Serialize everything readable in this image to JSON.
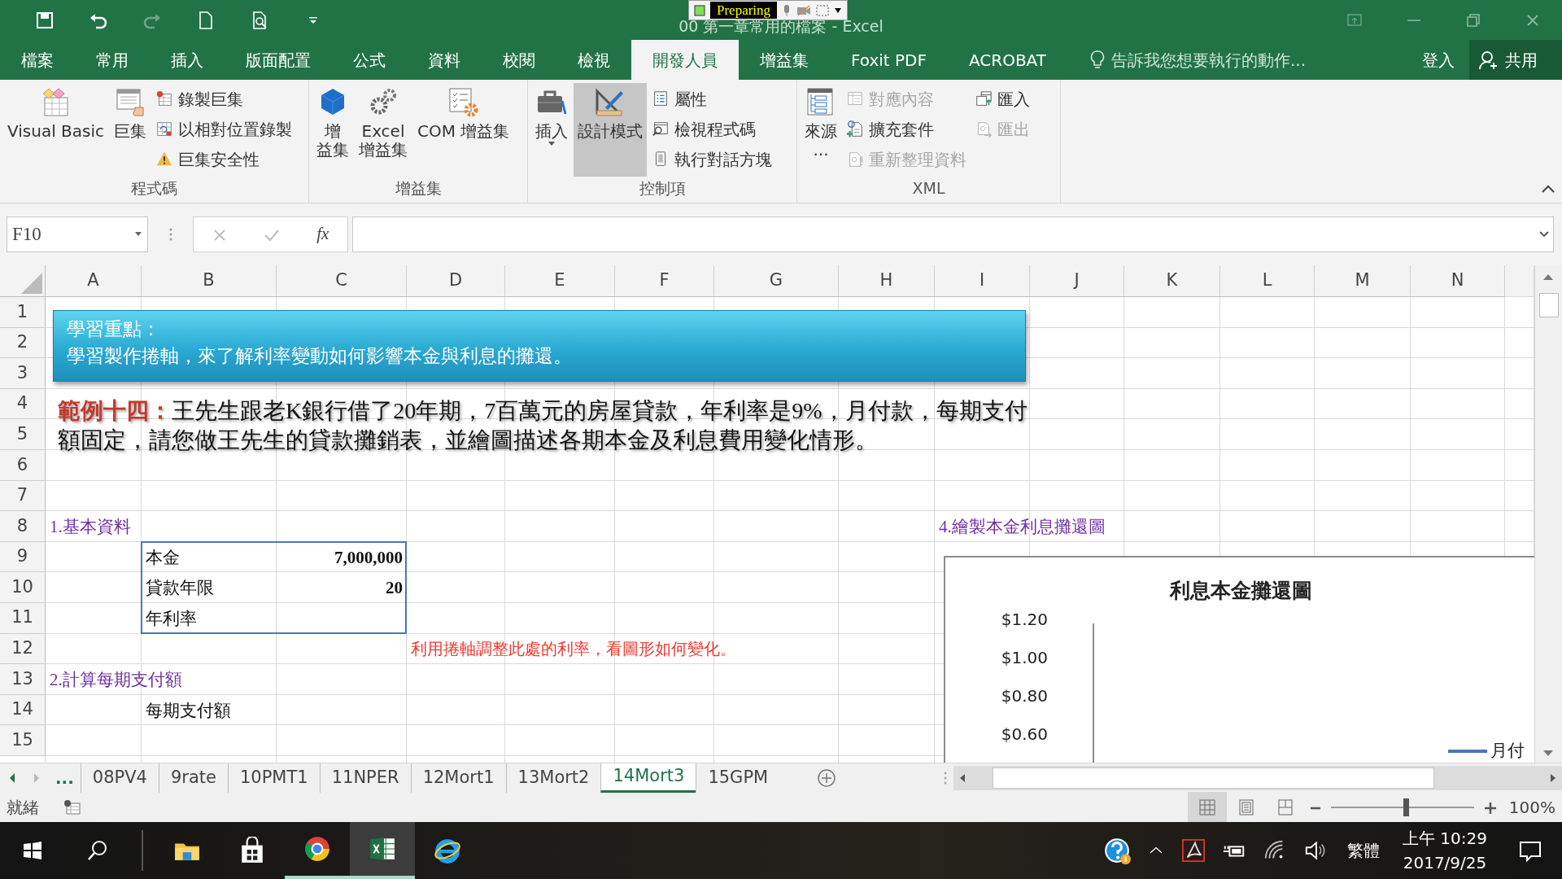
{
  "title_bar": {
    "title": "00 第一章常用的檔案 - Excel",
    "recorder": {
      "status": "Preparing"
    }
  },
  "tabs": [
    {
      "label": "檔案",
      "selected": false
    },
    {
      "label": "常用",
      "selected": false
    },
    {
      "label": "插入",
      "selected": false
    },
    {
      "label": "版面配置",
      "selected": false
    },
    {
      "label": "公式",
      "selected": false
    },
    {
      "label": "資料",
      "selected": false
    },
    {
      "label": "校閱",
      "selected": false
    },
    {
      "label": "檢視",
      "selected": false
    },
    {
      "label": "開發人員",
      "selected": true
    },
    {
      "label": "增益集",
      "selected": false
    },
    {
      "label": "Foxit PDF",
      "selected": false
    },
    {
      "label": "ACROBAT",
      "selected": false
    }
  ],
  "tell_me": {
    "placeholder": "告訴我您想要執行的動作..."
  },
  "sign_in": "登入",
  "share": "共用",
  "ribbon": {
    "groups": [
      {
        "title": "程式碼",
        "items": [
          {
            "kind": "large",
            "lines": [
              "Visual Basic"
            ],
            "pressed": false,
            "dropdown": false
          },
          {
            "kind": "large",
            "lines": [
              "巨集"
            ],
            "pressed": false,
            "dropdown": false
          },
          {
            "kind": "stack",
            "items": [
              {
                "label": "錄製巨集",
                "disabled": false
              },
              {
                "label": "以相對位置錄製",
                "disabled": false
              },
              {
                "label": "巨集安全性",
                "disabled": false
              }
            ]
          }
        ]
      },
      {
        "title": "增益集",
        "items": [
          {
            "kind": "large",
            "lines": [
              "增",
              "益集"
            ],
            "pressed": false,
            "dropdown": false
          },
          {
            "kind": "large",
            "lines": [
              "Excel",
              "增益集"
            ],
            "pressed": false,
            "dropdown": false
          },
          {
            "kind": "large",
            "lines": [
              "COM 增益集"
            ],
            "pressed": false,
            "dropdown": false
          }
        ]
      },
      {
        "title": "控制項",
        "items": [
          {
            "kind": "large",
            "lines": [
              "插入"
            ],
            "pressed": false,
            "dropdown": true
          },
          {
            "kind": "large",
            "lines": [
              "設計模式"
            ],
            "pressed": true,
            "dropdown": false
          },
          {
            "kind": "stack",
            "items": [
              {
                "label": "屬性",
                "disabled": false
              },
              {
                "label": "檢視程式碼",
                "disabled": false
              },
              {
                "label": "執行對話方塊",
                "disabled": false
              }
            ]
          }
        ]
      },
      {
        "title": "XML",
        "items": [
          {
            "kind": "large",
            "lines": [
              "來源",
              "..."
            ],
            "pressed": false,
            "dropdown": false
          },
          {
            "kind": "stack",
            "items": [
              {
                "label": "對應內容",
                "disabled": true
              },
              {
                "label": "擴充套件",
                "disabled": false
              },
              {
                "label": "重新整理資料",
                "disabled": true
              }
            ]
          },
          {
            "kind": "stack",
            "items": [
              {
                "label": "匯入",
                "disabled": false
              },
              {
                "label": "匯出",
                "disabled": true
              }
            ]
          }
        ]
      }
    ]
  },
  "formula_bar": {
    "name_box": "F10",
    "function_label": "fx"
  },
  "sheet": {
    "columns": [
      "A",
      "B",
      "C",
      "D",
      "E",
      "F",
      "G",
      "H",
      "I",
      "J",
      "K",
      "L",
      "M",
      "N"
    ],
    "rows": [
      "1",
      "2",
      "3",
      "4",
      "5",
      "6",
      "7",
      "8",
      "9",
      "10",
      "11",
      "12",
      "13",
      "14",
      "15"
    ],
    "banner": {
      "heading": "學習重點：",
      "text": "學習製作捲軸，來了解利率變動如何影響本金與利息的攤還。"
    },
    "problem": "**範例十四：**王先生跟老K銀行借了20年期，7百萬元的房屋貸款，年利率是9%，月付款，每期支付額固定，請您做王先生的貸款攤銷表，並繪圖描述各期本金及利息費用變化情形。",
    "cells": [
      {
        "kind": "heading",
        "text": "1.基本資料"
      },
      {
        "kind": "heading",
        "text": "4.繪製本金利息攤還圖"
      },
      {
        "kind": "label",
        "text": "本金"
      },
      {
        "kind": "number",
        "text": "7,000,000"
      },
      {
        "kind": "label",
        "text": "貸款年限"
      },
      {
        "kind": "number",
        "text": "20"
      },
      {
        "kind": "label",
        "text": "年利率"
      },
      {
        "kind": "note",
        "text": "利用捲軸調整此處的利率，看圖形如何變化。"
      },
      {
        "kind": "heading",
        "text": "2.計算每期支付額"
      },
      {
        "kind": "label",
        "text": "每期支付額"
      }
    ],
    "chart": {
      "title": "利息本金攤還圖",
      "y_ticks": [
        "$1.20",
        "$1.00",
        "$0.80",
        "$0.60"
      ],
      "legend": [
        {
          "label": "月付",
          "color": "#4a76b8"
        }
      ]
    }
  },
  "sheet_tabs": {
    "more": "...",
    "tabs": [
      {
        "label": "08PV4",
        "selected": false
      },
      {
        "label": "9rate",
        "selected": false
      },
      {
        "label": "10PMT1",
        "selected": false
      },
      {
        "label": "11NPER",
        "selected": false
      },
      {
        "label": "12Mort1",
        "selected": false
      },
      {
        "label": "13Mort2",
        "selected": false
      },
      {
        "label": "14Mort3",
        "selected": true
      },
      {
        "label": "15GPM",
        "selected": false
      }
    ]
  },
  "status_bar": {
    "text": "就緒",
    "views": [
      {
        "selected": true
      },
      {
        "selected": false
      },
      {
        "selected": false
      }
    ],
    "zoom": {
      "level": 0.52,
      "reading": "100%"
    }
  },
  "taskbar": {
    "apps": [
      {
        "running": false,
        "active": false
      },
      {
        "running": false,
        "active": false
      },
      {
        "running": true,
        "active": false
      },
      {
        "running": true,
        "active": true
      },
      {
        "running": false,
        "active": false
      }
    ],
    "input_method": "繁體",
    "time": "上午 10:29",
    "date": "2017/9/25"
  }
}
